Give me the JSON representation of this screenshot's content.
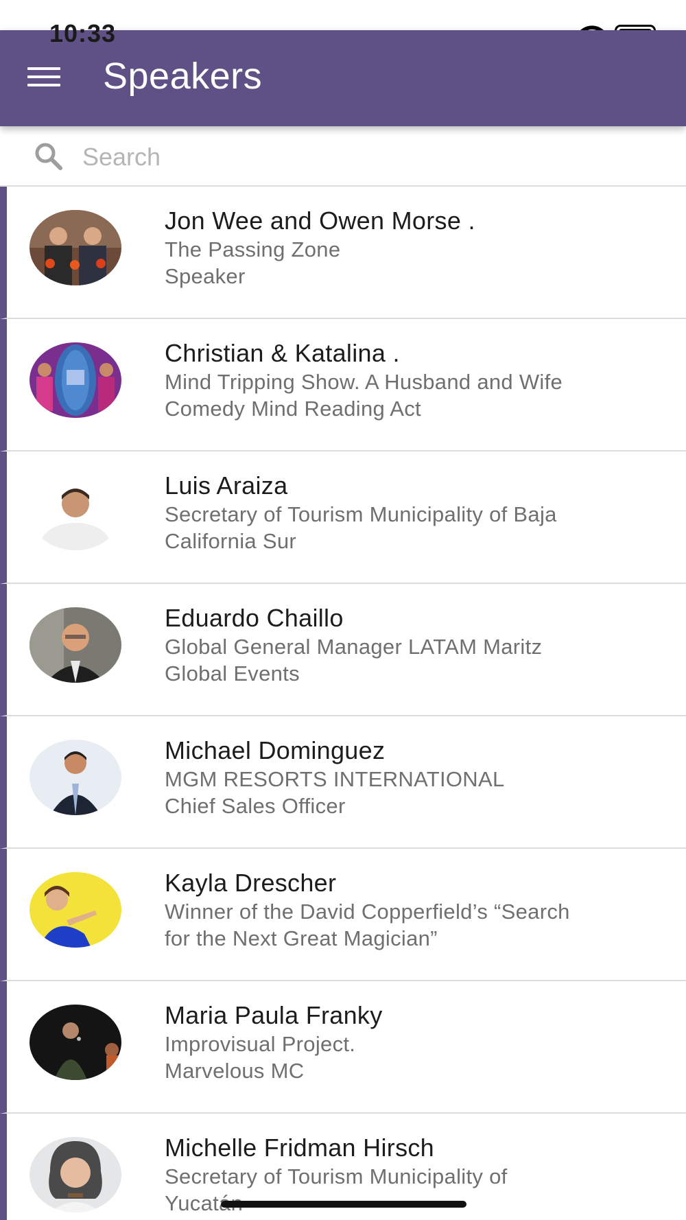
{
  "status_bar": {
    "time": "10:33"
  },
  "header": {
    "title": "Speakers"
  },
  "search": {
    "placeholder": "Search",
    "value": ""
  },
  "speakers": [
    {
      "name": "Jon Wee and Owen Morse .",
      "line1": "The Passing Zone",
      "line2": "Speaker",
      "avatar_icon": "speaker-photo-duo"
    },
    {
      "name": "Christian & Katalina .",
      "line1": "Mind Tripping Show. A Husband and Wife",
      "line2": "Comedy Mind Reading Act",
      "avatar_icon": "speaker-photo-show-poster"
    },
    {
      "name": "Luis Araiza",
      "line1": "Secretary of Tourism Municipality of Baja",
      "line2": "California Sur",
      "avatar_icon": "speaker-photo-portrait"
    },
    {
      "name": "Eduardo Chaillo",
      "line1": "Global General Manager LATAM Maritz",
      "line2": "Global Events",
      "avatar_icon": "speaker-photo-portrait"
    },
    {
      "name": "Michael Dominguez",
      "line1": "MGM RESORTS INTERNATIONAL",
      "line2": "Chief Sales Officer",
      "avatar_icon": "speaker-photo-portrait"
    },
    {
      "name": "Kayla Drescher",
      "line1": "Winner of the David Copperfield’s “Search",
      "line2": "for the Next Great Magician”",
      "avatar_icon": "speaker-photo-portrait"
    },
    {
      "name": "Maria Paula Franky",
      "line1": "Improvisual Project.",
      "line2": "Marvelous MC",
      "avatar_icon": "speaker-photo-stage"
    },
    {
      "name": "Michelle Fridman Hirsch",
      "line1": "Secretary of Tourism Municipality of",
      "line2": "Yucatán",
      "avatar_icon": "speaker-photo-portrait"
    }
  ],
  "colors": {
    "app_bar": "#5f5185",
    "row_accent": "#5f5185",
    "divider": "#dcdcdc",
    "name_text": "#1c1c1c",
    "sub_text": "#6f6f6f",
    "placeholder": "#b5b5b5"
  }
}
